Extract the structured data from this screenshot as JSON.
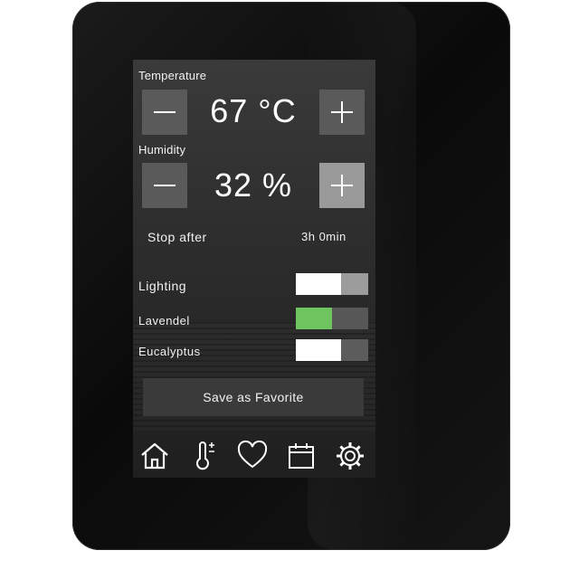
{
  "temperature": {
    "label": "Temperature",
    "value": "67 °C",
    "minus_icon": "minus-icon",
    "plus_icon": "plus-icon"
  },
  "humidity": {
    "label": "Humidity",
    "value": "32 %",
    "minus_icon": "minus-icon",
    "plus_icon": "plus-icon"
  },
  "stop_after": {
    "label": "Stop after",
    "value": "3h 0min"
  },
  "toggles": [
    {
      "label": "Lighting",
      "state": "on"
    },
    {
      "label": "Lavendel",
      "state": "on",
      "color": "#6ec45f"
    },
    {
      "label": "Eucalyptus",
      "state": "on"
    }
  ],
  "favorite_button": {
    "label": "Save as Favorite"
  },
  "nav": {
    "items": [
      {
        "icon": "home-icon"
      },
      {
        "icon": "thermometer-icon"
      },
      {
        "icon": "heart-icon"
      },
      {
        "icon": "calendar-icon"
      },
      {
        "icon": "gear-icon"
      }
    ]
  },
  "colors": {
    "accent_green": "#6ec45f",
    "screen_bg": "#2e2e2e",
    "bezel": "#111111"
  }
}
